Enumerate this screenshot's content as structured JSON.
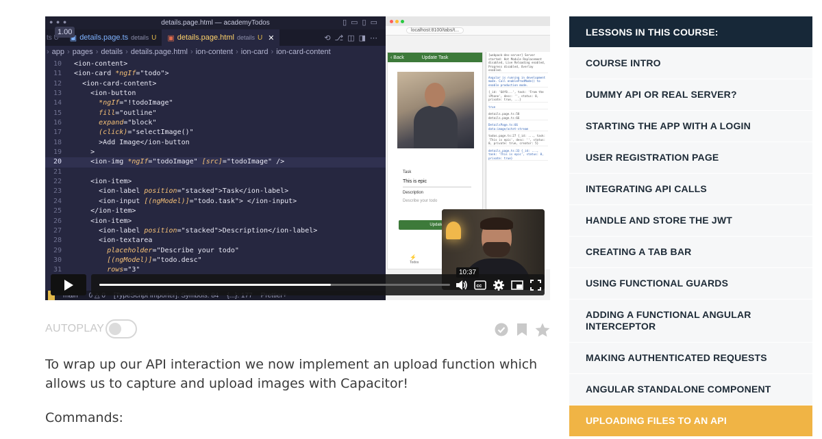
{
  "video": {
    "editor": {
      "window_title": "details.page.html — academyTodos",
      "zoom": "1.00",
      "tab_first": "ts U",
      "tabs": [
        {
          "name": "details.page.ts",
          "folder": "details",
          "mark": "U"
        },
        {
          "name": "details.page.html",
          "folder": "details",
          "mark": "U"
        }
      ],
      "breadcrumbs": [
        "app",
        "pages",
        "details",
        "details.page.html",
        "ion-content",
        "ion-card",
        "ion-card-content"
      ],
      "code_lines": [
        {
          "n": "10",
          "t": "  <ion-content>"
        },
        {
          "n": "11",
          "t": "  <ion-card *ngIf=\"todo\">"
        },
        {
          "n": "12",
          "t": "    <ion-card-content>"
        },
        {
          "n": "13",
          "t": "      <ion-button"
        },
        {
          "n": "14",
          "t": "        *ngIf=\"!todoImage\""
        },
        {
          "n": "15",
          "t": "        fill=\"outline\""
        },
        {
          "n": "16",
          "t": "        expand=\"block\""
        },
        {
          "n": "17",
          "t": "        (click)=\"selectImage()\""
        },
        {
          "n": "18",
          "t": "        >Add Image</ion-button"
        },
        {
          "n": "19",
          "t": "      >"
        },
        {
          "n": "20",
          "t": "      <ion-img *ngIf=\"todoImage\" [src]=\"todoImage\" />"
        },
        {
          "n": "21",
          "t": ""
        },
        {
          "n": "22",
          "t": "      <ion-item>"
        },
        {
          "n": "23",
          "t": "        <ion-label position=\"stacked\">Task</ion-label>"
        },
        {
          "n": "24",
          "t": "        <ion-input [(ngModel)]=\"todo.task\"> </ion-input>"
        },
        {
          "n": "25",
          "t": "      </ion-item>"
        },
        {
          "n": "26",
          "t": "      <ion-item>"
        },
        {
          "n": "27",
          "t": "        <ion-label position=\"stacked\">Description</ion-label>"
        },
        {
          "n": "28",
          "t": "        <ion-textarea"
        },
        {
          "n": "29",
          "t": "          placeholder=\"Describe your todo\""
        },
        {
          "n": "30",
          "t": "          [(ngModel)]=\"todo.desc\""
        },
        {
          "n": "31",
          "t": "          rows=\"3\""
        }
      ],
      "status": [
        "main*",
        "0 △ 0",
        "[TypeScript Importer]: Symbols: 84",
        "{...}: 177",
        "Prettier+"
      ]
    },
    "browser": {
      "url": "localhost:8100/tabs/t...",
      "app_header": "Update Task",
      "back": "Back",
      "task_label": "Task",
      "task_value": "This is epic",
      "desc_label": "Description",
      "desc_placeholder": "Describe your todo",
      "update_button": "Update",
      "tab_label": "Todos",
      "devtools_lines": [
        "[webpack-dev-server] Server started: Hot Module Replacement disabled, Live Reloading enabled, Progress disabled, Overlay enabled.",
        "Angular is running in development mode. Call enableProdMode() to enable production mode.",
        "{_id: '64f8...', task: 'From the iPhone', desc: '', status: 0, private: true, ...}",
        "true",
        "details.page.ts:58 details.page.ts:66",
        "DetailsPage.ts:66 data:image/octet-stream",
        "todos.page.ts:27 {_id: ..., task: 'This is epic', desc: '', status: 0, private: true, creator: 5}",
        "details.page.ts:33 {_id: ..., task: 'This is epic', status: 0, private: true}"
      ]
    },
    "player": {
      "time_tooltip": "10:37",
      "progress_fraction": 0.66
    }
  },
  "autoplay": {
    "label": "AUTOPLAY",
    "on": false
  },
  "description": "To wrap up our API interaction we now implement an upload function which allows us to capture and upload images with Capacitor!",
  "commands_label": "Commands:",
  "sidebar": {
    "header": "LESSONS IN THIS COURSE:",
    "items": [
      {
        "label": "COURSE INTRO",
        "active": false
      },
      {
        "label": "DUMMY API OR REAL SERVER?",
        "active": false
      },
      {
        "label": "STARTING THE APP WITH A LOGIN",
        "active": false
      },
      {
        "label": "USER REGISTRATION PAGE",
        "active": false
      },
      {
        "label": "INTEGRATING API CALLS",
        "active": false
      },
      {
        "label": "HANDLE AND STORE THE JWT",
        "active": false
      },
      {
        "label": "CREATING A TAB BAR",
        "active": false
      },
      {
        "label": "USING FUNCTIONAL GUARDS",
        "active": false
      },
      {
        "label": "ADDING A FUNCTIONAL ANGULAR INTERCEPTOR",
        "active": false
      },
      {
        "label": "MAKING AUTHENTICATED REQUESTS",
        "active": false
      },
      {
        "label": "ANGULAR STANDALONE COMPONENT",
        "active": false
      },
      {
        "label": "UPLOADING FILES TO AN API",
        "active": true
      }
    ]
  },
  "colors": {
    "sidebar_header_bg": "#172838",
    "sidebar_active_bg": "#f0b445",
    "app_green": "#3d7a3a"
  },
  "icons": {
    "player": [
      "play-icon",
      "volume-icon",
      "captions-icon",
      "settings-icon",
      "pip-icon",
      "fullscreen-icon"
    ],
    "actions": [
      "check-circle-icon",
      "bookmark-icon",
      "star-icon"
    ]
  }
}
